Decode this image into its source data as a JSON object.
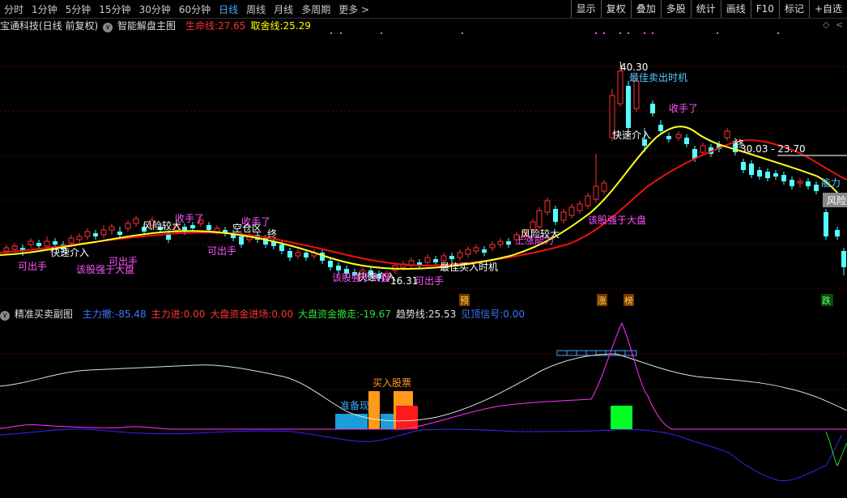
{
  "toolbar": {
    "periods": [
      "分时",
      "1分钟",
      "5分钟",
      "15分钟",
      "30分钟",
      "60分钟",
      "日线",
      "周线",
      "月线",
      "多周期",
      "更多 >"
    ],
    "active_period": "日线",
    "right_buttons": [
      "显示",
      "复权",
      "叠加",
      "多股",
      "统计",
      "画线",
      "F10",
      "标记",
      "+自选"
    ]
  },
  "main_header": {
    "stock": "宝通科技(日线 前复权)",
    "indicator_name": "智能解盘主图",
    "life_line_label": "生命线:",
    "life_line_value": "27.65",
    "sell_line_label": "取舍线:",
    "sell_line_value": "25.29"
  },
  "sub_header": {
    "name": "精准买卖副图",
    "fields": [
      {
        "label": "主力撤:",
        "value": "-85.48",
        "color": "#3c78ff"
      },
      {
        "label": "主力进:",
        "value": "0.00",
        "color": "#ff3333"
      },
      {
        "label": "大盘资金进场:",
        "value": "0.00",
        "color": "#ff3333"
      },
      {
        "label": "大盘资金撤走:",
        "value": "-19.67",
        "color": "#33dd33"
      },
      {
        "label": "趋势线:",
        "value": "25.53",
        "color": "#e0e0e0"
      },
      {
        "label": "见顶信号:",
        "value": "0.00",
        "color": "#3c78ff"
      }
    ]
  },
  "annotations": {
    "price_high": "40.30",
    "price_low": "16.31",
    "range_label": "30.03 - 23.70",
    "best_sell": "最佳卖出时机",
    "best_buy": "最佳买入时机",
    "quick_buy_1": "快速介入",
    "quick_buy_2": "快速介入",
    "quick_buy_3": "快速介入",
    "risk_1": "风险较大",
    "risk_2": "风险较大",
    "risk_3": "风险",
    "shoushou_1": "收手了",
    "shoushou_2": "收手了",
    "shoushou_3": "收手了",
    "stronger_1": "该股强于大盘",
    "stronger_2": "该股强于大盘",
    "stronger_3": "该股强于大盘",
    "can_sell_1": "可出手",
    "can_sell_2": "可出手",
    "can_sell_3": "可出手",
    "can_sell_4": "可出手",
    "empty_zone": "空仓区",
    "end_1": "终",
    "end_2": "终",
    "ability": "能力",
    "ability_2": "上涨能力",
    "tag_yu": "预",
    "tag_zhang": "涨",
    "tag_bang": "榜",
    "tag_die": "跌",
    "zhunbei": "准备现",
    "buy_stock": "买入股票"
  },
  "colors": {
    "up": "#ff3232",
    "down": "#54ffff",
    "life_line": "#ff0000",
    "sell_line": "#ffff00",
    "magenta": "#ff55ff",
    "white_line": "#dddddd",
    "blue_line": "#3c3cff"
  }
}
